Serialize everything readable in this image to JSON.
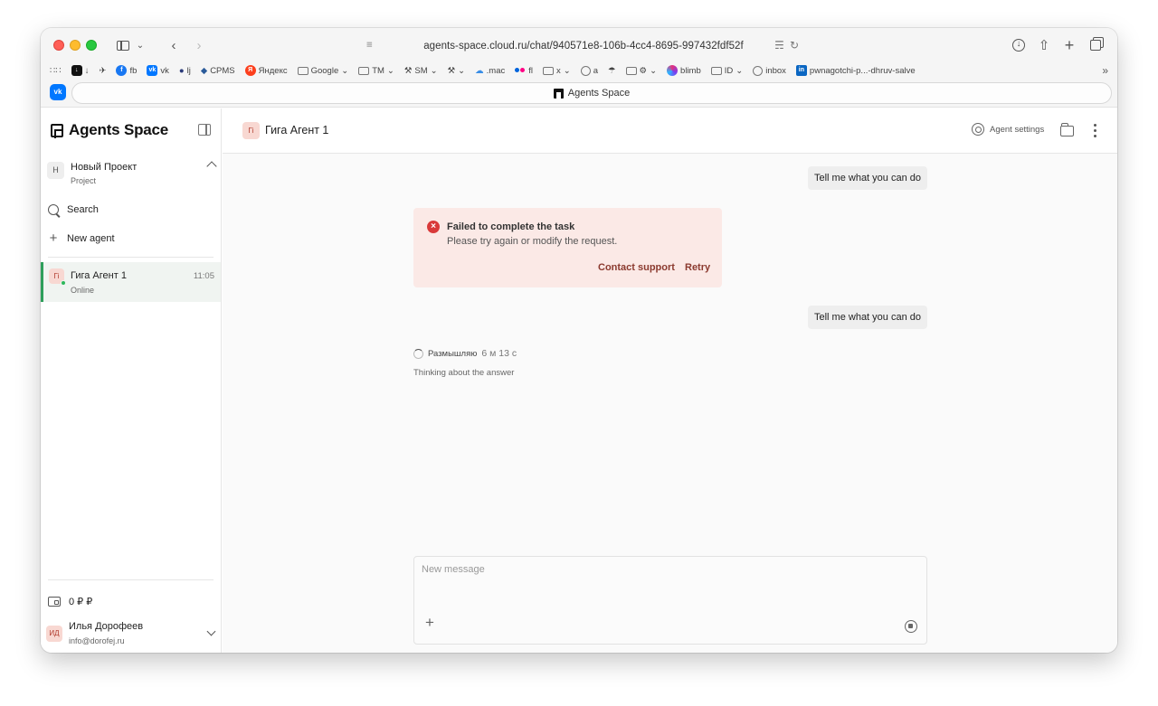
{
  "browser": {
    "url": "agents-space.cloud.ru/chat/940571e8-106b-4cc4-8695-997432fdf52f",
    "tab_title": "Agents Space",
    "bookmarks": [
      {
        "label": "↓",
        "icon": "download-bookmark"
      },
      {
        "label": "",
        "icon": "airplane-icon"
      },
      {
        "label": "fb",
        "icon": "facebook-icon"
      },
      {
        "label": "vk",
        "icon": "vk-icon"
      },
      {
        "label": "lj",
        "icon": "person-icon"
      },
      {
        "label": "CPMS",
        "icon": "cpms-icon"
      },
      {
        "label": "Яндекс",
        "icon": "yandex-icon"
      },
      {
        "label": "Google",
        "icon": "folder-icon"
      },
      {
        "label": "TM",
        "icon": "folder-icon"
      },
      {
        "label": "SM",
        "icon": "tools-icon"
      },
      {
        "label": "",
        "icon": "tools-icon"
      },
      {
        "label": ".mac",
        "icon": "cloud-icon"
      },
      {
        "label": "fl",
        "icon": "flickr-icon"
      },
      {
        "label": "x",
        "icon": "folder-icon"
      },
      {
        "label": "a",
        "icon": "globe-icon"
      },
      {
        "label": "",
        "icon": "umbrella-icon"
      },
      {
        "label": "",
        "icon": "folder-icon"
      },
      {
        "label": "blimb",
        "icon": "blimb-icon"
      },
      {
        "label": "ID",
        "icon": "folder-icon"
      },
      {
        "label": "inbox",
        "icon": "globe-icon"
      },
      {
        "label": "pwnagotchi-p...-dhruv-salve",
        "icon": "linkedin-icon"
      }
    ]
  },
  "sidebar": {
    "brand": "Agents Space",
    "project": {
      "badge": "Н",
      "name": "Новый Проект",
      "type": "Project"
    },
    "search_label": "Search",
    "new_agent_label": "New agent",
    "agents": [
      {
        "avatar": "Гі",
        "name": "Гига Агент 1",
        "status": "Online",
        "time": "11:05"
      }
    ],
    "balance": "0 ₽ ₽",
    "user": {
      "avatar": "ИД",
      "name": "Илья Дорофеев",
      "email": "info@dorofej.ru"
    }
  },
  "chat": {
    "avatar": "Гі",
    "title": "Гига Агент 1",
    "settings_label": "Agent settings",
    "messages": [
      {
        "role": "user",
        "text": "Tell me what you can do"
      },
      {
        "role": "error",
        "title": "Failed to complete the task",
        "text": "Please try again or modify the request.",
        "actions": [
          "Contact support",
          "Retry"
        ]
      },
      {
        "role": "user",
        "text": "Tell me what you can do"
      }
    ],
    "thinking": {
      "label": "Размышляю",
      "elapsed": "6 м 13 с",
      "subtitle": "Thinking about the answer"
    },
    "composer": {
      "placeholder": "New message",
      "value": ""
    }
  },
  "colors": {
    "accent_green": "#2e9f5b",
    "error_bg": "#fbe9e6",
    "error_icon": "#d93a3a",
    "error_action": "#8b3a2f",
    "avatar_bg": "#f8d8d2"
  }
}
